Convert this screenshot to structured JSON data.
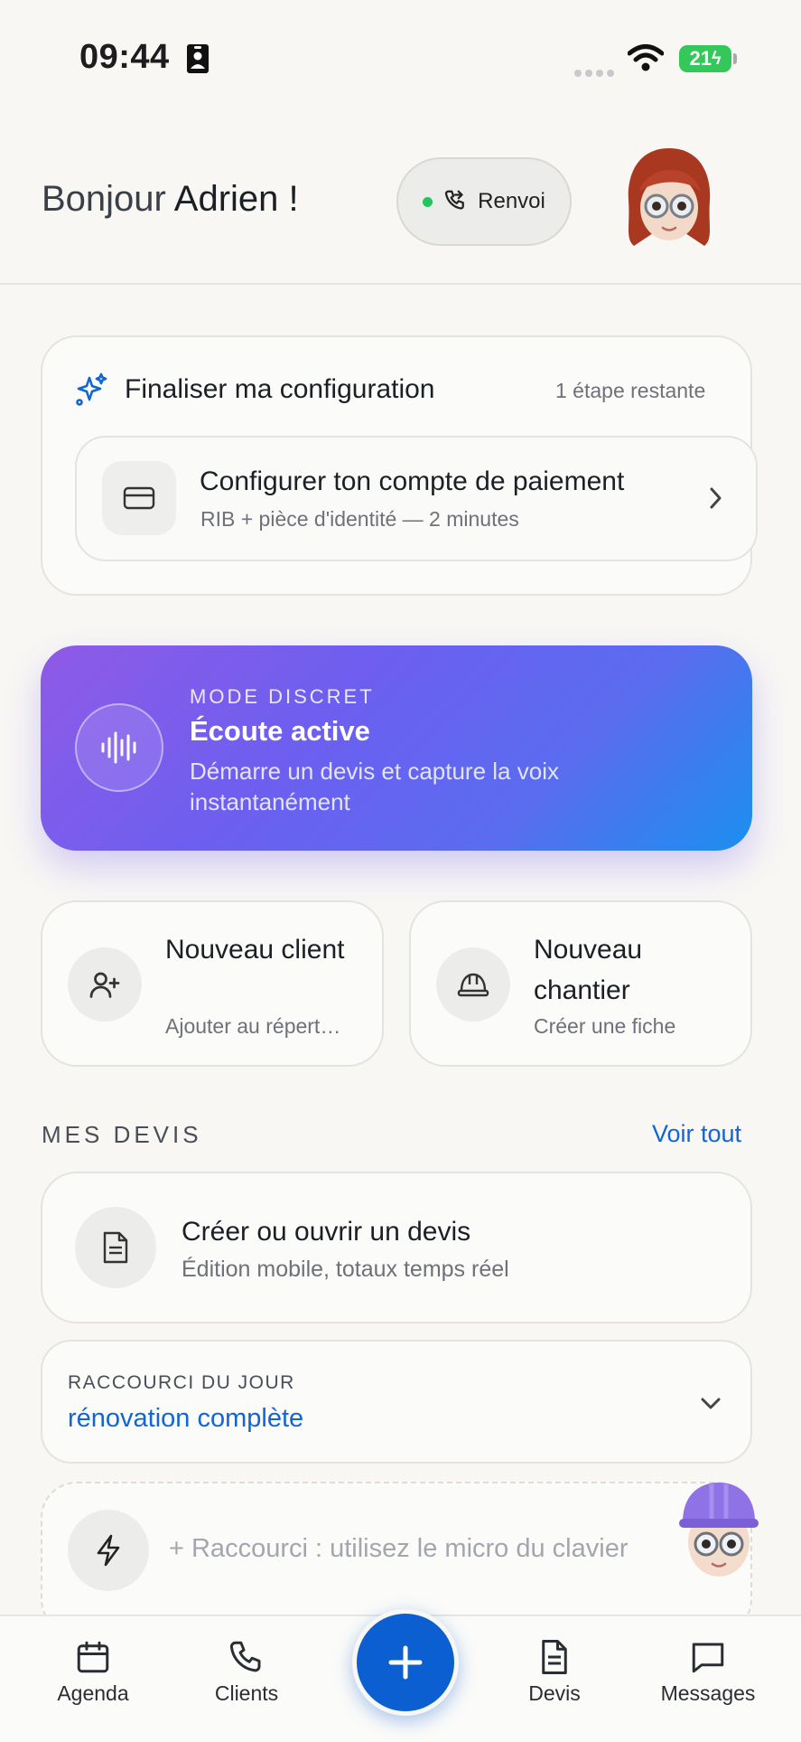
{
  "status_bar": {
    "time": "09:44",
    "battery": "21"
  },
  "header": {
    "greeting_prefix": "Bonjour",
    "name": "Adrien !",
    "renvoi_label": "Renvoi"
  },
  "config": {
    "title": "Finaliser ma configuration",
    "steps_remaining": "1 étape restante",
    "payment_title": "Configurer ton compte de paiement",
    "payment_subtitle": "RIB + pièce d'identité — 2 minutes"
  },
  "discreet_mode": {
    "kicker": "MODE DISCRET",
    "title": "Écoute active",
    "subtitle": "Démarre un devis et capture la voix instantanément"
  },
  "quick_actions": [
    {
      "title": "Nouveau client",
      "subtitle": "Ajouter au répertoire"
    },
    {
      "title": "Nouveau chantier",
      "subtitle": "Créer une fiche"
    }
  ],
  "devis": {
    "section_title": "MES DEVIS",
    "see_all": "Voir tout",
    "card_title": "Créer ou ouvrir un devis",
    "card_subtitle": "Édition mobile, totaux temps réel"
  },
  "shortcut_of_day": {
    "kicker": "RACCOURCI DU JOUR",
    "value": "rénovation complète"
  },
  "shortcut_hint": "+ Raccourci : utilisez le micro du clavier",
  "nav": [
    {
      "label": "Agenda"
    },
    {
      "label": "Clients"
    },
    {
      "label": "Devis"
    },
    {
      "label": "Messages"
    }
  ],
  "colors": {
    "accent": "#1265d4",
    "fab": "#0b5fd0",
    "status_dot": "#22c55e",
    "battery": "#34c759"
  }
}
